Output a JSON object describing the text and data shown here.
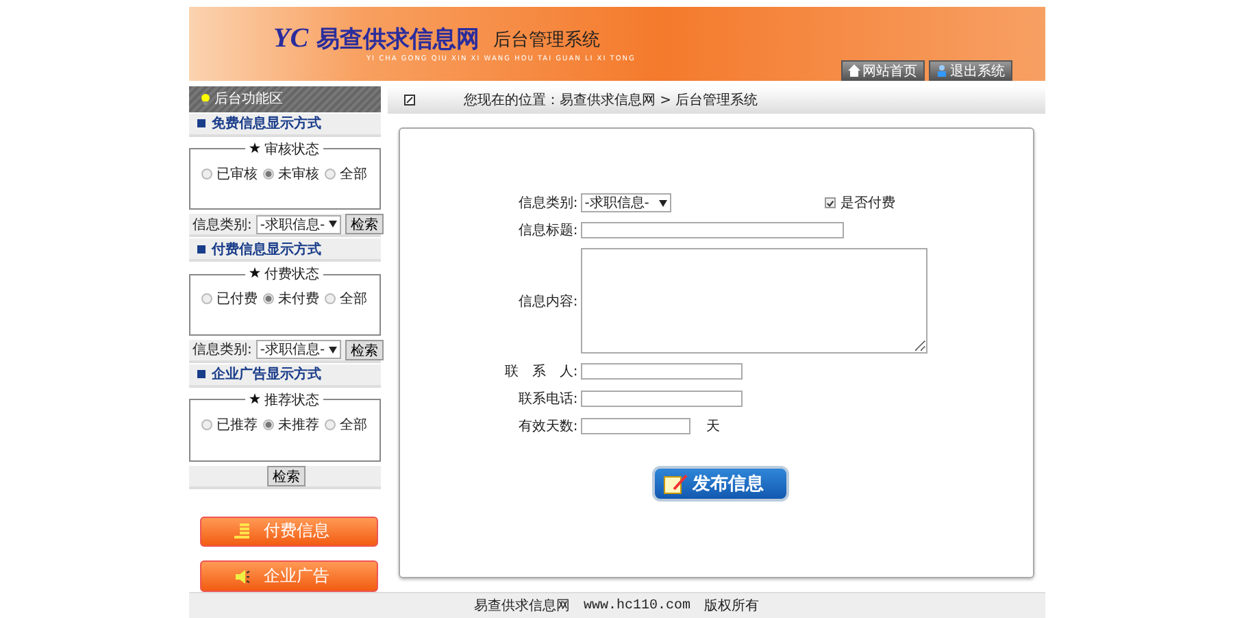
{
  "header": {
    "logo_mark": "YC",
    "title": "易查供求信息网",
    "subtitle": "后台管理系统",
    "pinyin": "YI CHA GONG QIU XIN XI WANG HOU TAI GUAN LI XI TONG",
    "buttons": [
      {
        "label": "网站首页",
        "kind": "home"
      },
      {
        "label": "退出系统",
        "kind": "exit"
      }
    ]
  },
  "sidebar": {
    "title": "后台功能区",
    "sections": [
      {
        "title": "免费信息显示方式",
        "legend": "审核状态",
        "options": [
          {
            "label": "已审核",
            "selected": false
          },
          {
            "label": "未审核",
            "selected": true
          },
          {
            "label": "全部",
            "selected": false
          }
        ],
        "kind": "filter",
        "filter_label": "信息类别:",
        "filter_value": "-求职信息-",
        "button": "检索"
      },
      {
        "title": "付费信息显示方式",
        "legend": "付费状态",
        "options": [
          {
            "label": "已付费",
            "selected": false
          },
          {
            "label": "未付费",
            "selected": true
          },
          {
            "label": "全部",
            "selected": false
          }
        ],
        "kind": "filter",
        "filter_label": "信息类别:",
        "filter_value": "-求职信息-",
        "button": "检索"
      },
      {
        "title": "企业广告显示方式",
        "legend": "推荐状态",
        "options": [
          {
            "label": "已推荐",
            "selected": false
          },
          {
            "label": "未推荐",
            "selected": true
          },
          {
            "label": "全部",
            "selected": false
          }
        ],
        "kind": "button",
        "button": "检索"
      }
    ],
    "links": [
      {
        "label": "付费信息",
        "kind": "coins"
      },
      {
        "label": "企业广告",
        "kind": "speaker"
      }
    ]
  },
  "breadcrumb": {
    "prefix": "您现在的位置：",
    "items": [
      "易查供求信息网",
      "后台管理系统"
    ],
    "separator": ">"
  },
  "form": {
    "fields": [
      {
        "label": "信息类别:",
        "kind": "select",
        "value": "-求职信息-"
      },
      {
        "label": "信息标题:",
        "kind": "input"
      },
      {
        "label": "信息内容:",
        "kind": "textarea"
      },
      {
        "label": "联　系　人:",
        "kind": "short"
      },
      {
        "label": "联系电话:",
        "kind": "short"
      },
      {
        "label": "有效天数:",
        "kind": "days",
        "suffix": "天"
      }
    ],
    "checkbox": {
      "label": "是否付费",
      "checked": true
    },
    "submit": "发布信息"
  },
  "footer": {
    "site": "易查供求信息网",
    "url": "www.hc110.com",
    "rights": "版权所有"
  }
}
